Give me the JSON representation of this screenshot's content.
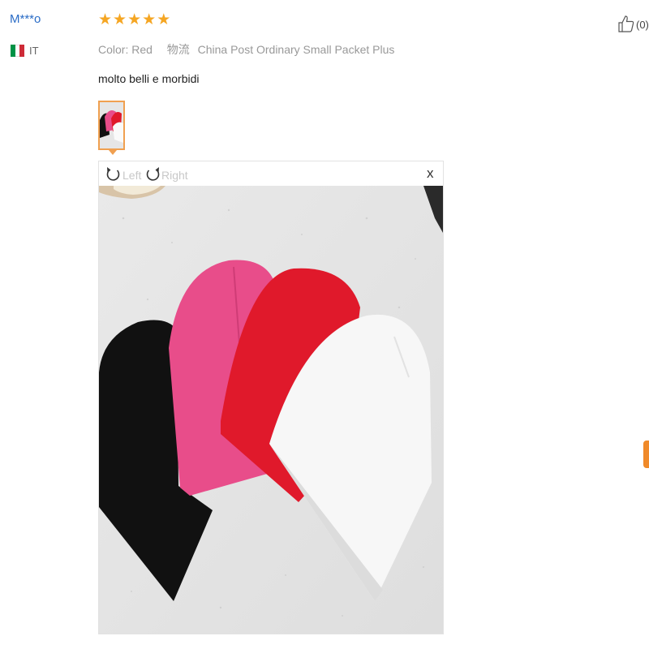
{
  "reviewer": {
    "name": "M***o",
    "country_code": "IT",
    "flag_colors": [
      "#009246",
      "#ffffff",
      "#ce2b37"
    ]
  },
  "rating": {
    "stars": 5,
    "max": 5,
    "star_glyph": "★",
    "star_color": "#f5a623"
  },
  "order_info": {
    "color_label": "Color:",
    "color_value": "Red",
    "shipping_label": "物流",
    "shipping_value": "China Post Ordinary Small Packet Plus"
  },
  "review_text": "molto belli e morbidi",
  "helpful": {
    "icon": "thumbs-up-icon",
    "count": "(0)"
  },
  "viewer": {
    "rotate_left_label": "Left",
    "rotate_right_label": "Right",
    "close_label": "x"
  },
  "photo": {
    "subject": "beanie-hats",
    "hat_colors": [
      "#111111",
      "#e84d8a",
      "#e0192b",
      "#f6f6f6"
    ]
  },
  "colors": {
    "accent": "#f0a050",
    "link": "#2a6cc6"
  }
}
